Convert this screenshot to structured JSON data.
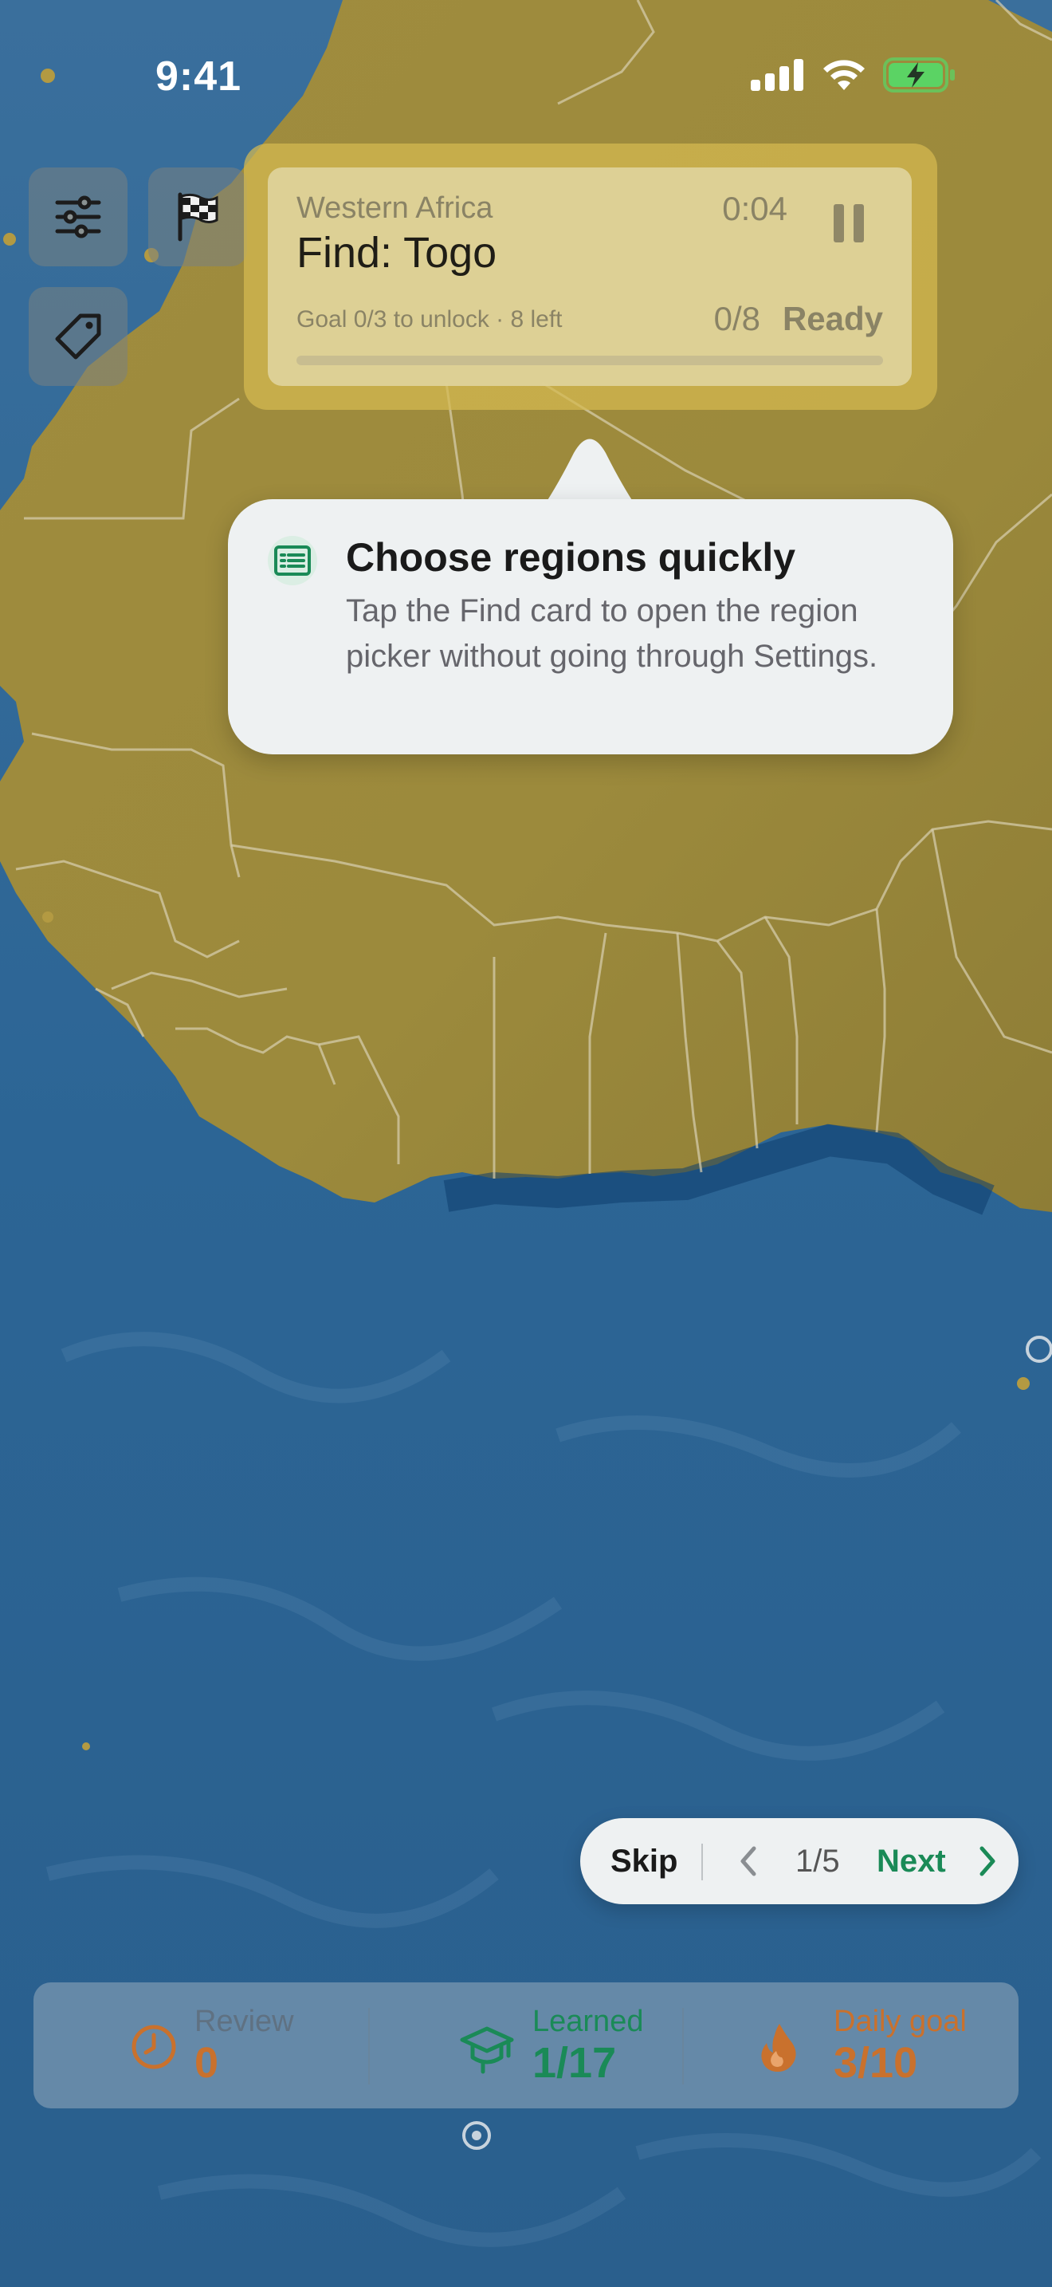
{
  "status_bar": {
    "time": "9:41"
  },
  "colors": {
    "ocean": "#2d6292",
    "land": "#a3903f",
    "find_card": "#ddd29b",
    "accent_green": "#1a8a57",
    "accent_orange": "#c9712d"
  },
  "toolbar": {
    "buttons": [
      {
        "icon": "sliders-icon"
      },
      {
        "icon": "checkered-flag-icon"
      },
      {
        "icon": "tag-icon"
      }
    ]
  },
  "find_card": {
    "region": "Western Africa",
    "title": "Find: Togo",
    "timer": "0:04",
    "goal_text": "Goal 0/3 to unlock · 8 left",
    "count": "0/8",
    "status": "Ready",
    "progress": 0
  },
  "tooltip": {
    "icon": "list-card-icon",
    "title": "Choose regions quickly",
    "body": "Tap the Find card to open the region picker without going through Settings."
  },
  "coach_nav": {
    "skip_label": "Skip",
    "page": "1/5",
    "next_label": "Next"
  },
  "stats": {
    "review": {
      "label": "Review",
      "value": "0",
      "icon": "clock-icon"
    },
    "learned": {
      "label": "Learned",
      "value": "1/17",
      "icon": "graduation-cap-icon"
    },
    "daily_goal": {
      "label": "Daily goal",
      "value": "3/10",
      "icon": "flame-icon"
    }
  }
}
